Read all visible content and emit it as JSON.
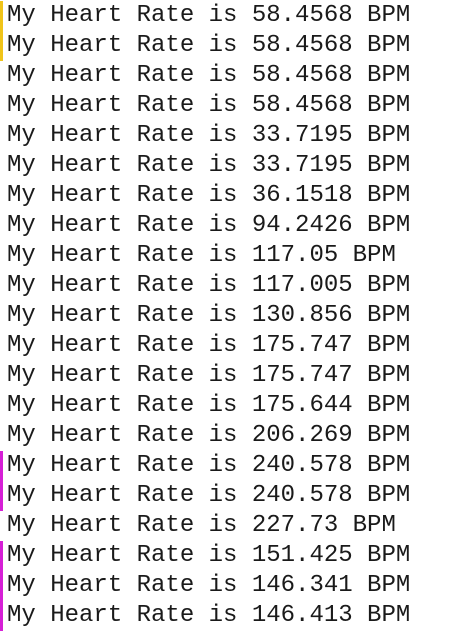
{
  "console": {
    "accent_colors": {
      "yellow": "#f0c419",
      "magenta": "#d61fd6"
    },
    "lines": [
      {
        "text": "My Heart Rate is 58.4568 BPM",
        "marker": "yellow"
      },
      {
        "text": "My Heart Rate is 58.4568 BPM",
        "marker": "yellow"
      },
      {
        "text": "My Heart Rate is 58.4568 BPM",
        "marker": "none"
      },
      {
        "text": "My Heart Rate is 58.4568 BPM",
        "marker": "none"
      },
      {
        "text": "My Heart Rate is 33.7195 BPM",
        "marker": "none"
      },
      {
        "text": "My Heart Rate is 33.7195 BPM",
        "marker": "none"
      },
      {
        "text": "My Heart Rate is 36.1518 BPM",
        "marker": "none"
      },
      {
        "text": "My Heart Rate is 94.2426 BPM",
        "marker": "none"
      },
      {
        "text": "My Heart Rate is 117.05 BPM",
        "marker": "none"
      },
      {
        "text": "My Heart Rate is 117.005 BPM",
        "marker": "none"
      },
      {
        "text": "My Heart Rate is 130.856 BPM",
        "marker": "none"
      },
      {
        "text": "My Heart Rate is 175.747 BPM",
        "marker": "none"
      },
      {
        "text": "My Heart Rate is 175.747 BPM",
        "marker": "none"
      },
      {
        "text": "My Heart Rate is 175.644 BPM",
        "marker": "none"
      },
      {
        "text": "My Heart Rate is 206.269 BPM",
        "marker": "none"
      },
      {
        "text": "My Heart Rate is 240.578 BPM",
        "marker": "magenta"
      },
      {
        "text": "My Heart Rate is 240.578 BPM",
        "marker": "magenta"
      },
      {
        "text": "My Heart Rate is 227.73 BPM",
        "marker": "none"
      },
      {
        "text": "My Heart Rate is 151.425 BPM",
        "marker": "magenta"
      },
      {
        "text": "My Heart Rate is 146.341 BPM",
        "marker": "magenta"
      },
      {
        "text": "My Heart Rate is 146.413 BPM",
        "marker": "magenta"
      }
    ]
  }
}
